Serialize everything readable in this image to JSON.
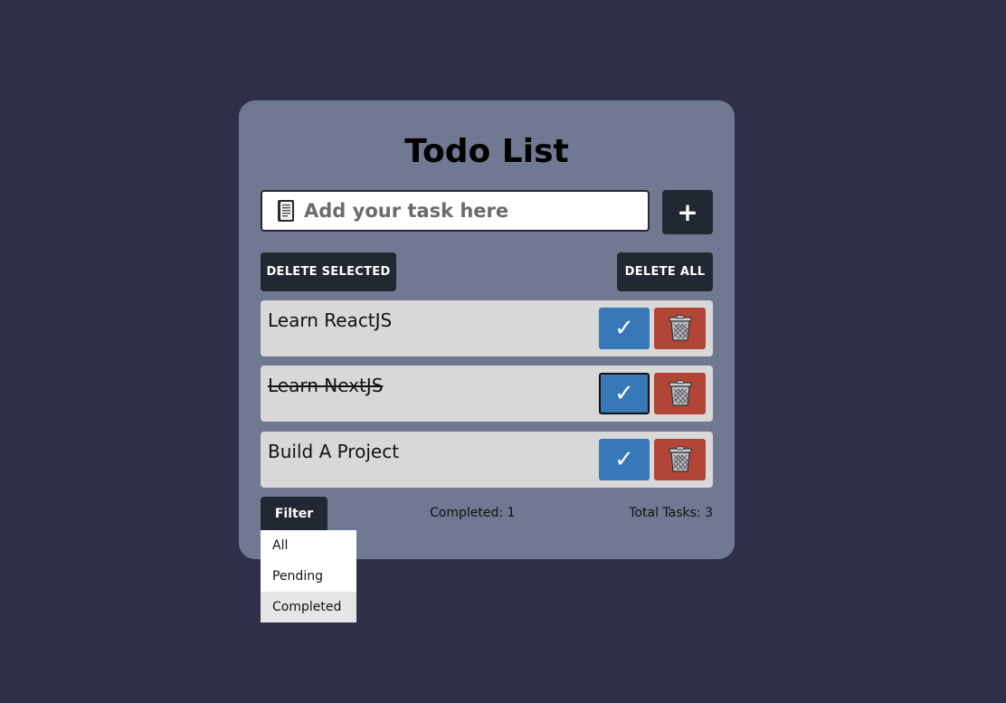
{
  "app": {
    "title": "Todo List"
  },
  "input": {
    "placeholder": "Add your task here",
    "value": "",
    "icon": "notebook-icon"
  },
  "toolbar": {
    "add_label": "+",
    "delete_selected_label": "DELETE SELECTED",
    "delete_all_label": "DELETE ALL"
  },
  "todos": [
    {
      "text": "Learn ReactJS",
      "completed": false,
      "check_label": "✓",
      "delete_icon": "trash-icon"
    },
    {
      "text": "Learn NextJS",
      "completed": true,
      "check_label": "✓",
      "delete_icon": "trash-icon"
    },
    {
      "text": "Build A Project",
      "completed": false,
      "check_label": "✓",
      "delete_icon": "trash-icon"
    }
  ],
  "footer": {
    "filter_label": "Filter",
    "completed_text": "Completed: 1",
    "total_text": "Total Tasks: 3"
  },
  "filter_menu": {
    "options": [
      "All",
      "Pending",
      "Completed"
    ],
    "highlighted": "Completed"
  },
  "colors": {
    "background": "#2f3047",
    "card": "#717892",
    "dark_button": "#212831",
    "check_button": "#3778b8",
    "delete_button": "#b14536",
    "item_background": "#d8d8d8"
  }
}
